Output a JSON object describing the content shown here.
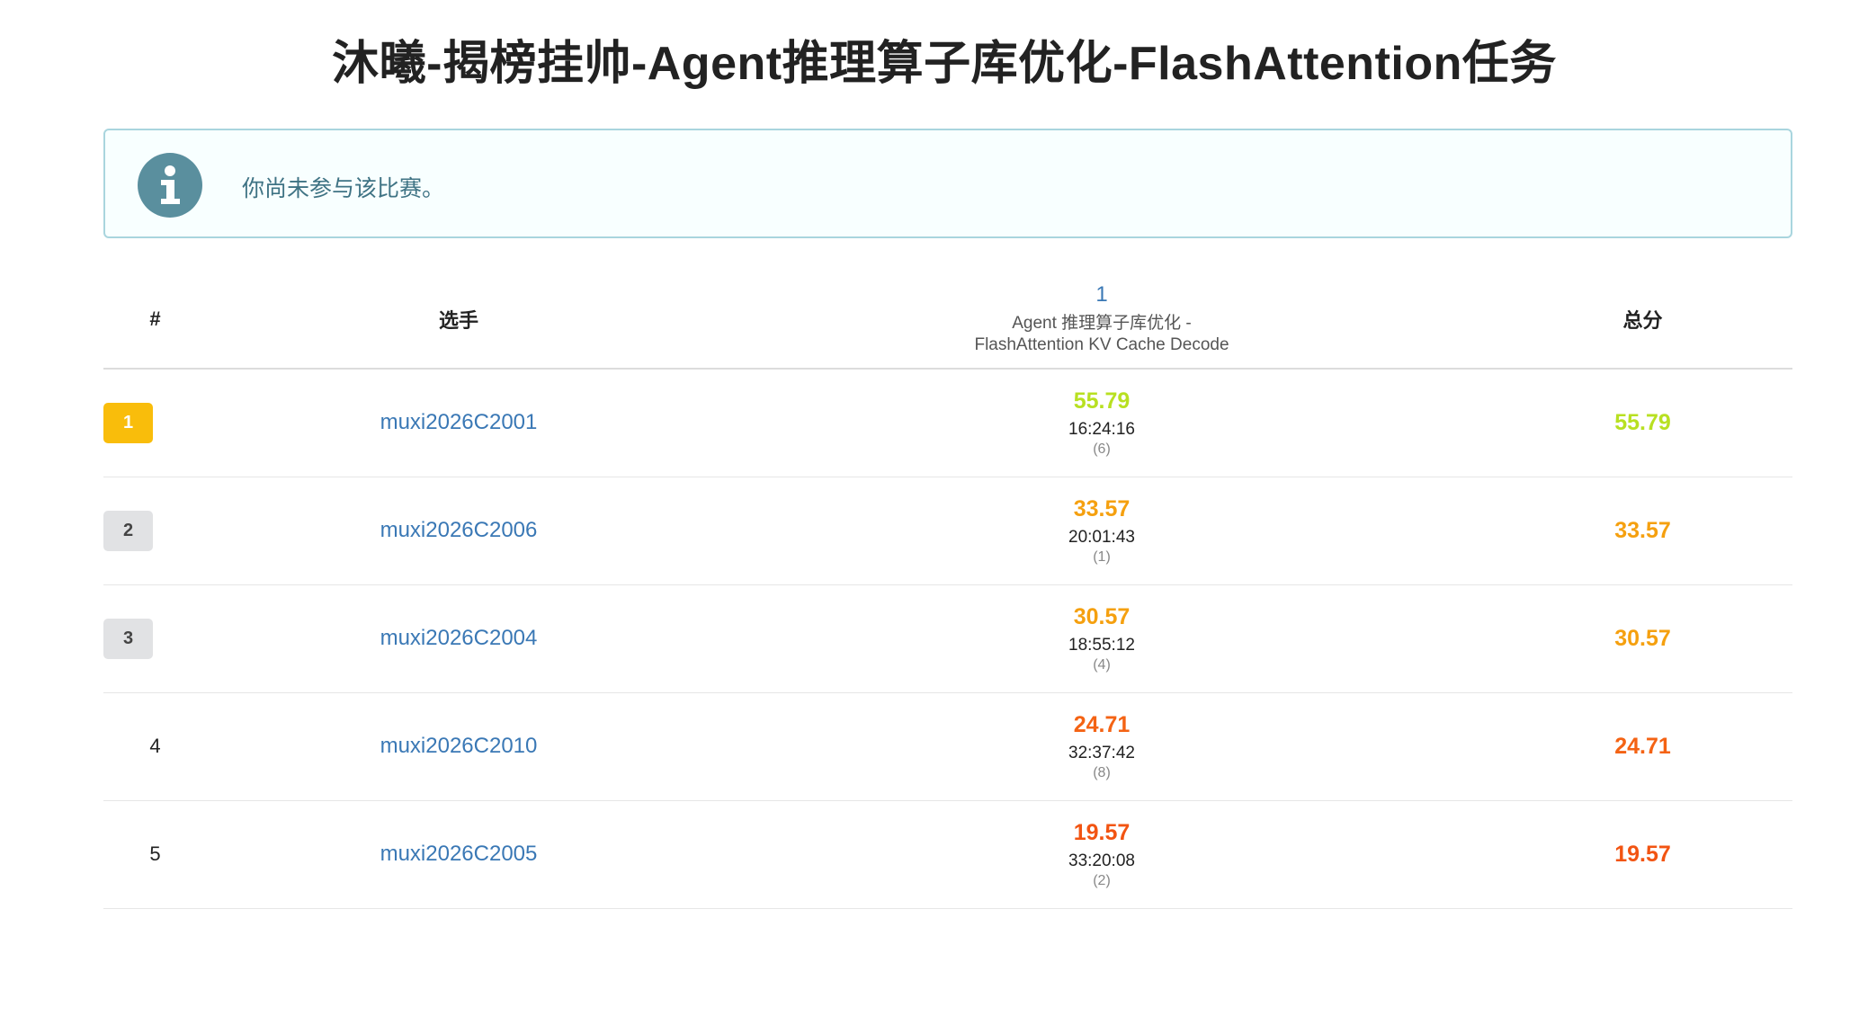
{
  "title": "沐曦-揭榜挂帅-Agent推理算子库优化-FlashAttention任务",
  "alert": {
    "message": "你尚未参与该比赛。",
    "icon": "info-icon"
  },
  "columns": {
    "rank": "#",
    "player": "选手",
    "problem_number": "1",
    "problem_title_line1": "Agent 推理算子库优化 -",
    "problem_title_line2": "FlashAttention KV Cache Decode",
    "total": "总分"
  },
  "rows": [
    {
      "rank": "1",
      "user": "muxi2026C2001",
      "score": "55.79",
      "time": "16:24:16",
      "tries": "(6)",
      "total": "55.79",
      "rank_bg": "#f9bd0b",
      "rank_fg": "#ffffff",
      "score_color": "#b8e021"
    },
    {
      "rank": "2",
      "user": "muxi2026C2006",
      "score": "33.57",
      "time": "20:01:43",
      "tries": "(1)",
      "total": "33.57",
      "rank_bg": "#e1e2e4",
      "rank_fg": "#444444",
      "score_color": "#f5a00f"
    },
    {
      "rank": "3",
      "user": "muxi2026C2004",
      "score": "30.57",
      "time": "18:55:12",
      "tries": "(4)",
      "total": "30.57",
      "rank_bg": "#e1e2e4",
      "rank_fg": "#444444",
      "score_color": "#f5a00f"
    },
    {
      "rank": "4",
      "user": "muxi2026C2010",
      "score": "24.71",
      "time": "32:37:42",
      "tries": "(8)",
      "total": "24.71",
      "rank_bg": "",
      "rank_fg": "#222222",
      "score_color": "#f46314"
    },
    {
      "rank": "5",
      "user": "muxi2026C2005",
      "score": "19.57",
      "time": "33:20:08",
      "tries": "(2)",
      "total": "19.57",
      "rank_bg": "",
      "rank_fg": "#222222",
      "score_color": "#f25412"
    }
  ]
}
